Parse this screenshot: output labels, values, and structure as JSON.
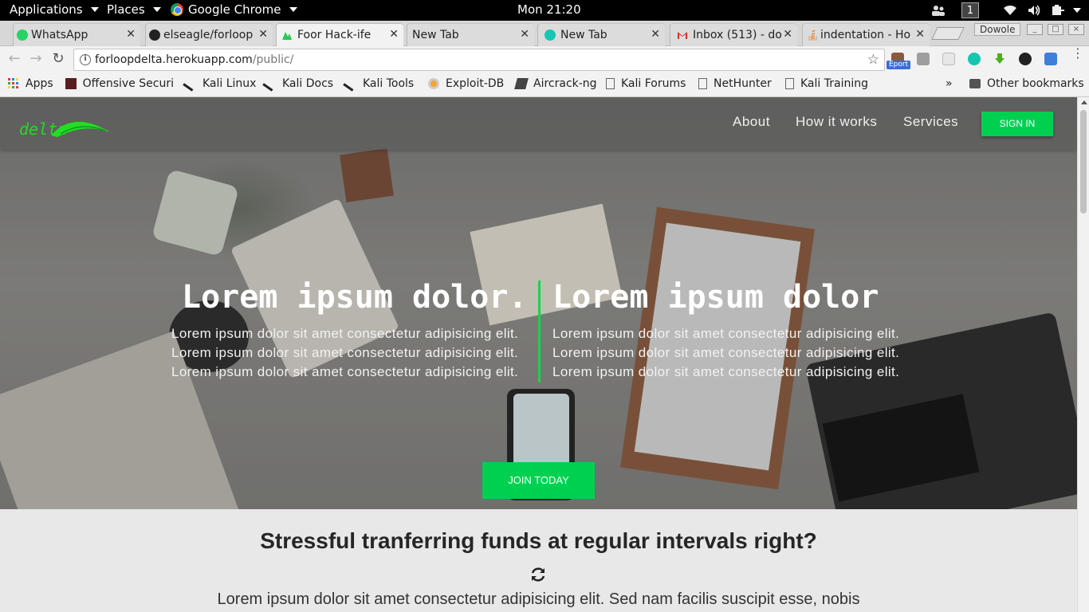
{
  "topbar": {
    "applications": "Applications",
    "places": "Places",
    "browser": "Google Chrome",
    "clock": "Mon 21:20",
    "workspace": "1"
  },
  "tabs": [
    {
      "label": "WhatsApp",
      "color": "#25d366",
      "active": false
    },
    {
      "label": "elseagle/forloop",
      "color": "#222222",
      "active": false
    },
    {
      "label": "Foor Hack-ife",
      "color": "#22cc55",
      "active": true
    },
    {
      "label": "New Tab",
      "color": "",
      "active": false
    },
    {
      "label": "New Tab",
      "color": "#16c6b0",
      "active": false
    },
    {
      "label": "Inbox (513) - do",
      "color": "#d93025",
      "active": false
    },
    {
      "label": "indentation - Ho",
      "color": "#f48024",
      "active": false
    }
  ],
  "window": {
    "profile": "Dowole",
    "minimize": "_",
    "maximize": "□",
    "close": "×"
  },
  "omnibox": {
    "host": "forloopdelta.herokuapp.com",
    "path": "/public/"
  },
  "extensions": {
    "badge": "Eport"
  },
  "bookmarks": [
    {
      "label": "Apps"
    },
    {
      "label": "Offensive Securi"
    },
    {
      "label": "Kali Linux"
    },
    {
      "label": "Kali Docs"
    },
    {
      "label": "Kali Tools"
    },
    {
      "label": "Exploit-DB"
    },
    {
      "label": "Aircrack-ng"
    },
    {
      "label": "Kali Forums"
    },
    {
      "label": "NetHunter"
    },
    {
      "label": "Kali Training"
    }
  ],
  "bookmarks_more": "»",
  "other_bookmarks": "Other bookmarks",
  "site": {
    "logo": "delta",
    "nav": [
      "About",
      "How it works",
      "Services"
    ],
    "signin": "SIGN IN",
    "hero": {
      "left_heading": "Lorem ipsum dolor.",
      "right_heading": "Lorem ipsum dolor",
      "line": "Lorem ipsum dolor sit amet consectetur adipisicing elit.",
      "cta": "JOIN TODAY"
    },
    "section": {
      "title": "Stressful tranferring funds at regular intervals right?",
      "text": "Lorem ipsum dolor sit amet consectetur adipisicing elit. Sed nam facilis suscipit esse, nobis"
    }
  },
  "colors": {
    "accent": "#00d050",
    "divider": "#1fd14a"
  }
}
